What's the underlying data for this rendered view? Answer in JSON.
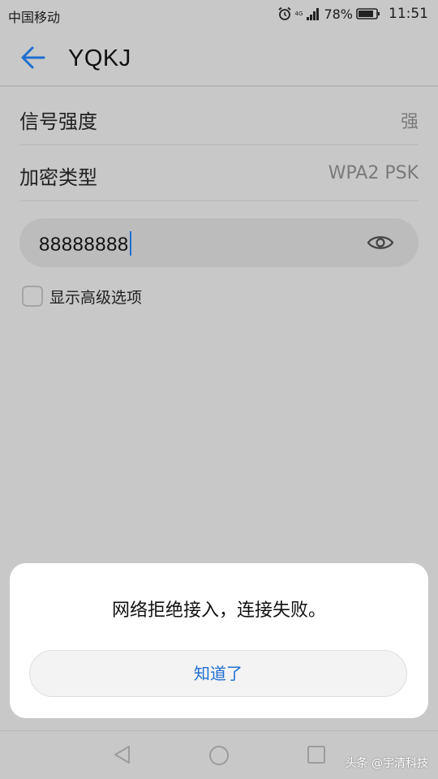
{
  "status_bar": {
    "carrier": "中国移动",
    "network_label": "4G",
    "battery_percent": "78%",
    "time": "11:51",
    "icons": [
      "alarm-icon",
      "signal-icon",
      "battery-icon"
    ]
  },
  "header": {
    "back_icon": "arrow-left-icon",
    "title": "YQKJ"
  },
  "details": {
    "signal_strength": {
      "label": "信号强度",
      "value": "强"
    },
    "encryption": {
      "label": "加密类型",
      "value": "WPA2 PSK"
    }
  },
  "password": {
    "value": "88888888",
    "visibility_icon": "eye-icon"
  },
  "advanced": {
    "label": "显示高级选项",
    "checked": false
  },
  "dialog": {
    "message": "网络拒绝接入，连接失败。",
    "button_label": "知道了"
  },
  "nav": {
    "icons": [
      "back-triangle-icon",
      "home-circle-icon",
      "recents-square-icon"
    ]
  },
  "watermark": "头条 @宇清科技",
  "colors": {
    "accent": "#1f6fd0",
    "background": "#c8c8c8",
    "dialog": "#ffffff"
  }
}
